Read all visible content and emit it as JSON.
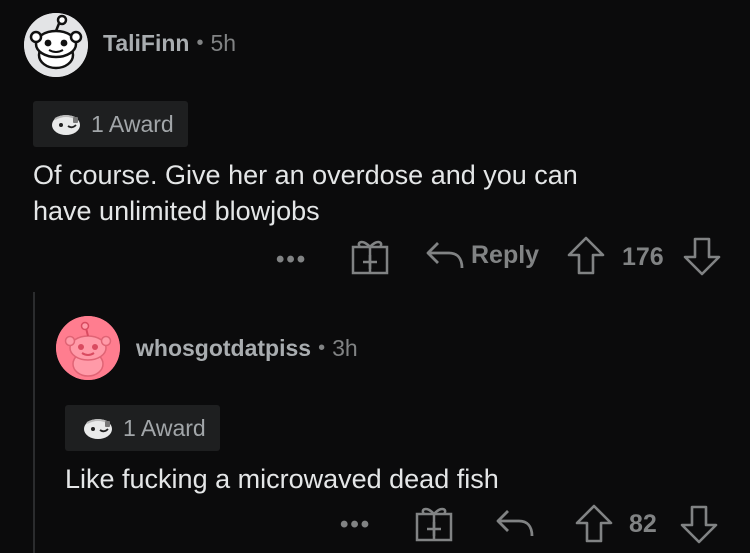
{
  "comment1": {
    "username": "TaliFinn",
    "separator": "•",
    "age": "5h",
    "award_label": "1 Award",
    "body_line1": "Of course. Give her an overdose and you can",
    "body_line2": "have unlimited blowjobs",
    "more": "•••",
    "reply_label": "Reply",
    "score": "176"
  },
  "comment2": {
    "username": "whosgotdatpiss",
    "separator": "•",
    "age": "3h",
    "award_label": "1 Award",
    "body": "Like fucking a microwaved dead fish",
    "more": "•••",
    "score": "82"
  },
  "colors": {
    "background": "#0b0b0c",
    "avatar1_bg": "#e3e4e6",
    "avatar2_bg": "#ff7d8f"
  },
  "icons": [
    "snoo-avatar-icon",
    "award-icon",
    "gift-icon",
    "reply-icon",
    "upvote-icon",
    "downvote-icon"
  ]
}
